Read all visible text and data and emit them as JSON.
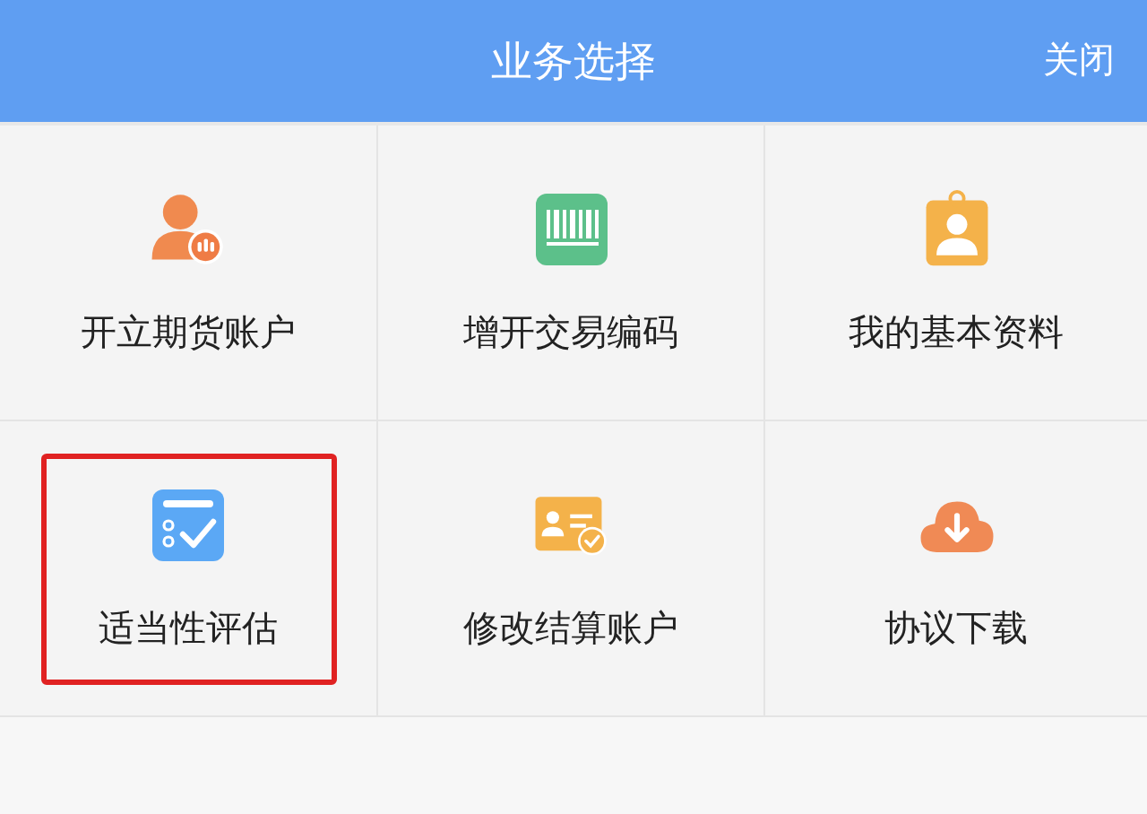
{
  "header": {
    "title": "业务选择",
    "close": "关闭"
  },
  "items": [
    {
      "label": "开立期货账户",
      "kind": "person",
      "highlighted": false
    },
    {
      "label": "增开交易编码",
      "kind": "barcode",
      "highlighted": false
    },
    {
      "label": "我的基本资料",
      "kind": "badge",
      "highlighted": false
    },
    {
      "label": "适当性评估",
      "kind": "checklist",
      "highlighted": true
    },
    {
      "label": "修改结算账户",
      "kind": "card",
      "highlighted": false
    },
    {
      "label": "协议下载",
      "kind": "download",
      "highlighted": false
    }
  ]
}
